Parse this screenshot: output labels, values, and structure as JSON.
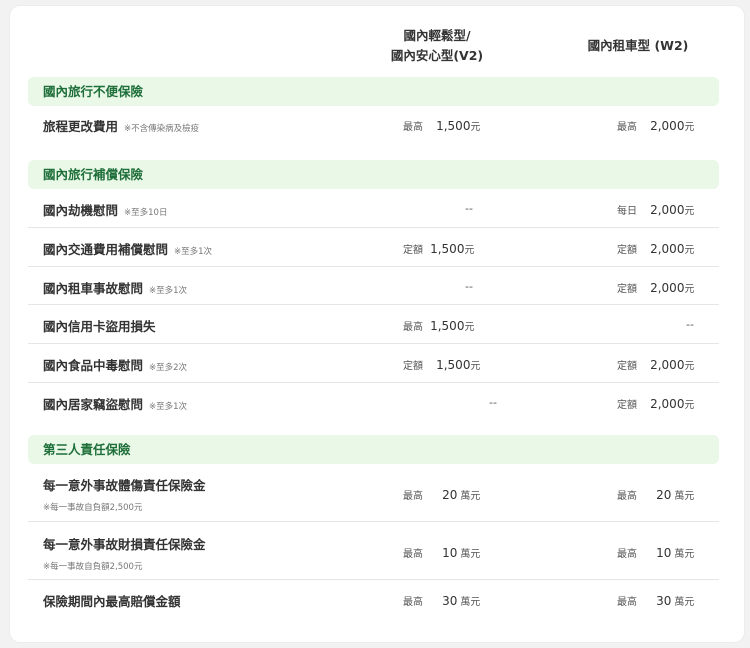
{
  "header": {
    "col1_line1": "國內輕鬆型/",
    "col1_line2": "國內安心型(V2)",
    "col2": "國內租車型 (W2)"
  },
  "sections": [
    {
      "title": "國內旅行不便保險"
    },
    {
      "title": "國內旅行補償保險"
    },
    {
      "title": "第三人責任保險"
    }
  ],
  "rows": [
    {
      "label": "旅程更改費用",
      "note": "※不含傳染病及檢疫",
      "c1": {
        "prefix": "最高",
        "amount": "1,500",
        "unit": "元"
      },
      "c2": {
        "prefix": "最高",
        "amount": "2,000",
        "unit": "元"
      }
    },
    {
      "label": "國內劫機慰問",
      "note": "※至多10日",
      "c1": {
        "dash": "--"
      },
      "c2": {
        "prefix": "每日",
        "amount": "2,000",
        "unit": "元"
      }
    },
    {
      "label": "國內交通費用補償慰問",
      "note": "※至多1次",
      "c1": {
        "prefix": "定額",
        "amount": "1,500",
        "unit": "元"
      },
      "c2": {
        "prefix": "定額",
        "amount": "2,000",
        "unit": "元"
      }
    },
    {
      "label": "國內租車事故慰問",
      "note": "※至多1次",
      "c1": {
        "dash": "--"
      },
      "c2": {
        "prefix": "定額",
        "amount": "2,000",
        "unit": "元"
      }
    },
    {
      "label": "國內信用卡盜用損失",
      "note": "",
      "c1": {
        "prefix": "最高",
        "amount": "1,500",
        "unit": "元"
      },
      "c2": {
        "dash": "--"
      }
    },
    {
      "label": "國內食品中毒慰問",
      "note": "※至多2次",
      "c1": {
        "prefix": "定額",
        "amount": "1,500",
        "unit": "元"
      },
      "c2": {
        "prefix": "定額",
        "amount": "2,000",
        "unit": "元"
      }
    },
    {
      "label": "國內居家竊盜慰問",
      "note": "※至多1次",
      "c1": {
        "dash": "--"
      },
      "c2": {
        "prefix": "定額",
        "amount": "2,000",
        "unit": "元"
      }
    },
    {
      "label": "每一意外事故體傷責任保險金",
      "subnote": "※每一事故自負額2,500元",
      "c1": {
        "prefix": "最高",
        "amount": "20",
        "unit": "萬元"
      },
      "c2": {
        "prefix": "最高",
        "amount": "20",
        "unit": "萬元"
      }
    },
    {
      "label": "每一意外事故財損責任保險金",
      "subnote": "※每一事故自負額2,500元",
      "c1": {
        "prefix": "最高",
        "amount": "10",
        "unit": "萬元"
      },
      "c2": {
        "prefix": "最高",
        "amount": "10",
        "unit": "萬元"
      }
    },
    {
      "label": "保險期間內最高賠償金額",
      "c1": {
        "prefix": "最高",
        "amount": "30",
        "unit": "萬元"
      },
      "c2": {
        "prefix": "最高",
        "amount": "30",
        "unit": "萬元"
      }
    }
  ]
}
